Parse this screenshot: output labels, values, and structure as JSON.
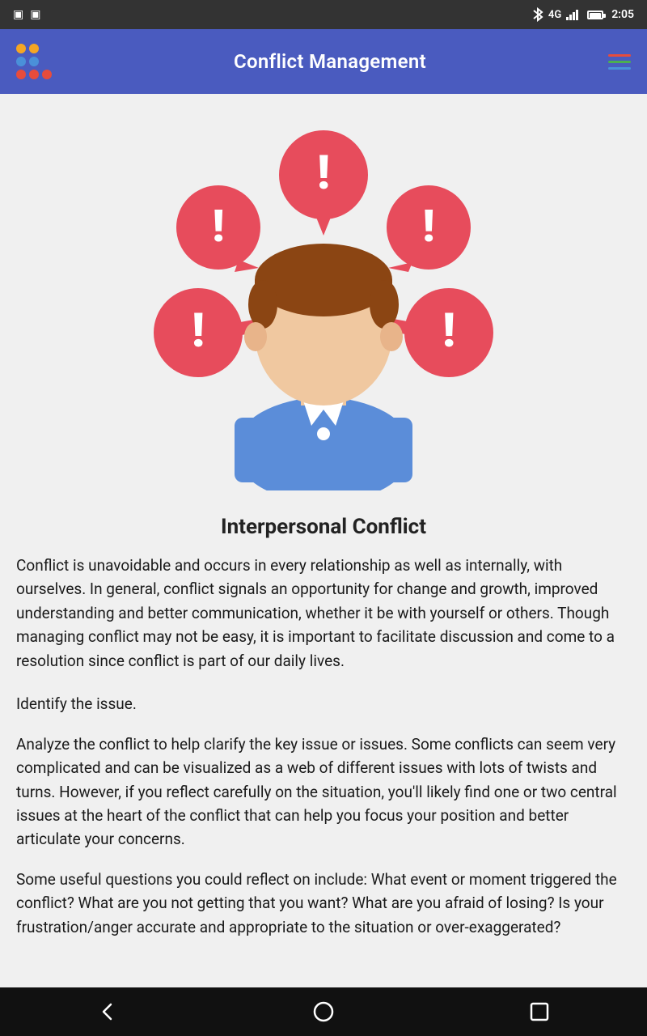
{
  "statusBar": {
    "time": "2:05",
    "networkType": "4G"
  },
  "appBar": {
    "title": "Conflict Management",
    "logoColors": [
      "#f5a623",
      "#f5a623",
      "#4CAF50",
      "#4a5bbf",
      "#4a5bbf",
      "#e74c3c",
      "#e74c3c",
      "#e74c3c",
      "#f5a623"
    ],
    "menuLines": [
      "#e74c3c",
      "#4CAF50",
      "#4a5bbf"
    ]
  },
  "illustration": {
    "heading": "Interpersonal Conflict"
  },
  "content": {
    "paragraph1": "Conflict is unavoidable and occurs in every relationship as well as internally, with ourselves. In general, conflict signals an opportunity for change and growth, improved understanding and better communication, whether it be with yourself or others. Though managing conflict may not be easy, it is important to facilitate discussion and come to a resolution since conflict is part of our daily lives.",
    "point1": "Identify the issue.",
    "point2": " Analyze the conflict to help clarify the key issue or issues. Some conflicts can seem very complicated and can be visualized as a web of different issues with lots of twists and turns. However, if you reflect carefully on the situation, you'll likely find one or two central issues at the heart of the conflict that can help you focus your position and better articulate your concerns.",
    "point3": " Some useful questions you could reflect on include: What event or moment triggered the conflict? What are you not getting that you want? What are you afraid of losing? Is your frustration/anger accurate and appropriate to the situation or over-exaggerated?"
  }
}
